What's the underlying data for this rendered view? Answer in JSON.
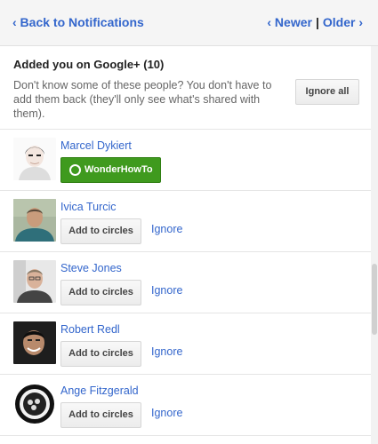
{
  "nav": {
    "back_label": "‹ Back to Notifications",
    "newer_label": "‹ Newer",
    "separator": "|",
    "older_label": "Older ›"
  },
  "section": {
    "title": "Added you on Google+ (10)",
    "description": "Don't know some of these people? You don't have to add them back (they'll only see what's shared with them).",
    "ignore_all_label": "Ignore all"
  },
  "people": [
    {
      "name": "Marcel Dykiert",
      "action_label": "WonderHowTo",
      "ignore_label": ""
    },
    {
      "name": "Ivica Turcic",
      "action_label": "Add to circles",
      "ignore_label": "Ignore"
    },
    {
      "name": "Steve Jones",
      "action_label": "Add to circles",
      "ignore_label": "Ignore"
    },
    {
      "name": "Robert Redl",
      "action_label": "Add to circles",
      "ignore_label": "Ignore"
    },
    {
      "name": "Ange Fitzgerald",
      "action_label": "Add to circles",
      "ignore_label": "Ignore"
    }
  ],
  "colors": {
    "link": "#3366cc",
    "green_button": "#3f9a1e"
  },
  "icons": {
    "circle_ring": "circle-ring-icon"
  }
}
